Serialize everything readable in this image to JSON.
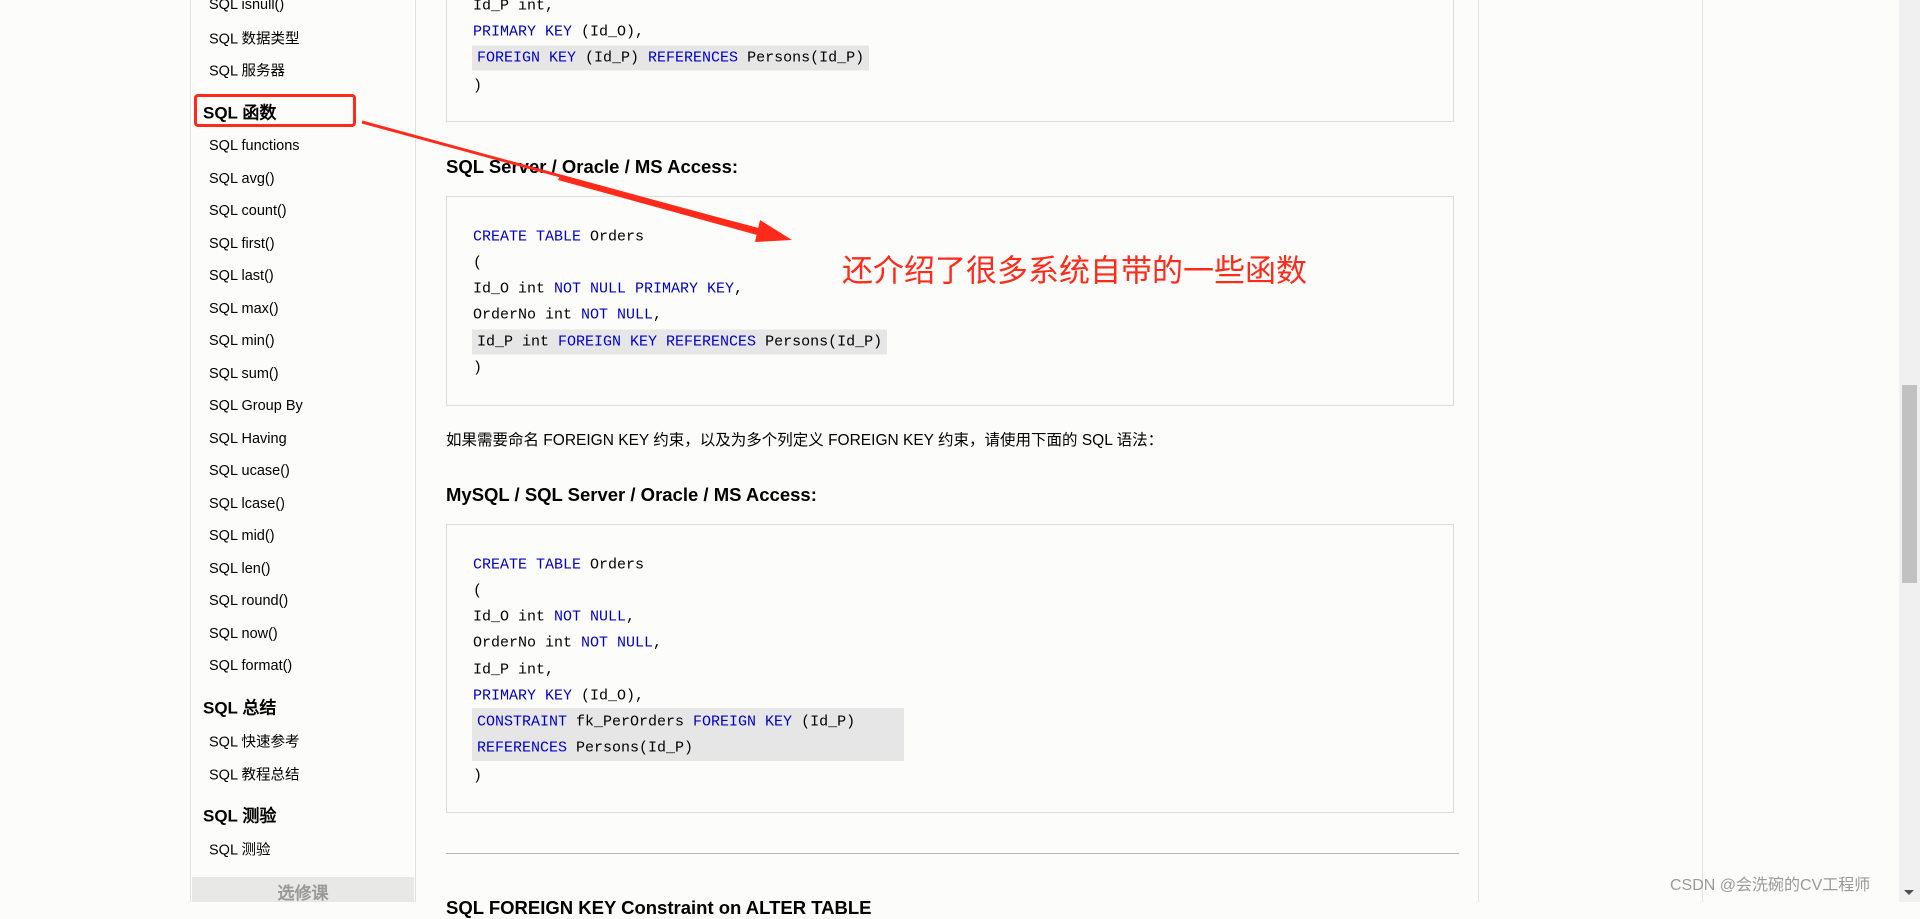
{
  "sidebar": {
    "items_top": [
      "SQL isnull()",
      "SQL 数据类型",
      "SQL 服务器"
    ],
    "functions_heading": "SQL 函数",
    "functions": [
      "SQL functions",
      "SQL avg()",
      "SQL count()",
      "SQL first()",
      "SQL last()",
      "SQL max()",
      "SQL min()",
      "SQL sum()",
      "SQL Group By",
      "SQL Having",
      "SQL ucase()",
      "SQL lcase()",
      "SQL mid()",
      "SQL len()",
      "SQL round()",
      "SQL now()",
      "SQL format()"
    ],
    "summary_heading": "SQL 总结",
    "summary": [
      "SQL 快速参考",
      "SQL 教程总结"
    ],
    "quiz_heading": "SQL 测验",
    "quiz": [
      "SQL 测验"
    ],
    "elective_button": "选修课"
  },
  "content": {
    "code1": {
      "l1": "Id_P int,",
      "l2_kw": "PRIMARY KEY",
      "l2_rest": " (Id_O),",
      "l3_kw1": "FOREIGN KEY",
      "l3_mid": " (Id_P) ",
      "l3_kw2": "REFERENCES",
      "l3_rest": " Persons(Id_P)",
      "l4": ")"
    },
    "heading1": "SQL Server / Oracle / MS Access:",
    "code2": {
      "l1_kw": "CREATE TABLE",
      "l1_rest": " Orders",
      "l2": "(",
      "l3_a": "Id_O int ",
      "l3_kw": "NOT NULL PRIMARY KEY",
      "l3_b": ",",
      "l4_a": "OrderNo int ",
      "l4_kw": "NOT NULL",
      "l4_b": ",",
      "l5_a": "Id_P int ",
      "l5_kw": "FOREIGN KEY REFERENCES",
      "l5_b": " Persons(Id_P)",
      "l6": ")"
    },
    "paragraph": "如果需要命名 FOREIGN KEY 约束，以及为多个列定义 FOREIGN KEY 约束，请使用下面的 SQL 语法：",
    "heading2": "MySQL / SQL Server / Oracle / MS Access:",
    "code3": {
      "l1_kw": "CREATE TABLE",
      "l1_rest": " Orders",
      "l2": "(",
      "l3_a": "Id_O int ",
      "l3_kw": "NOT NULL",
      "l3_b": ",",
      "l4_a": "OrderNo int ",
      "l4_kw": "NOT NULL",
      "l4_b": ",",
      "l5": "Id_P int,",
      "l6_kw": "PRIMARY KEY",
      "l6_rest": " (Id_O),",
      "l7_kw1": "CONSTRAINT",
      "l7_mid": " fk_PerOrders ",
      "l7_kw2": "FOREIGN KEY",
      "l7_rest": " (Id_P)",
      "l8_kw": "REFERENCES",
      "l8_rest": " Persons(Id_P)",
      "l9": ")"
    },
    "heading3": "SQL FOREIGN KEY Constraint on ALTER TABLE"
  },
  "annotation": {
    "text": "还介绍了很多系统自带的一些函数",
    "color": "#ff2a1a"
  },
  "watermark": "CSDN @会洗碗的CV工程师",
  "colors": {
    "keyword": "#0000cd",
    "highlight": "#e6e6e6",
    "background": "#fcfcfa"
  }
}
